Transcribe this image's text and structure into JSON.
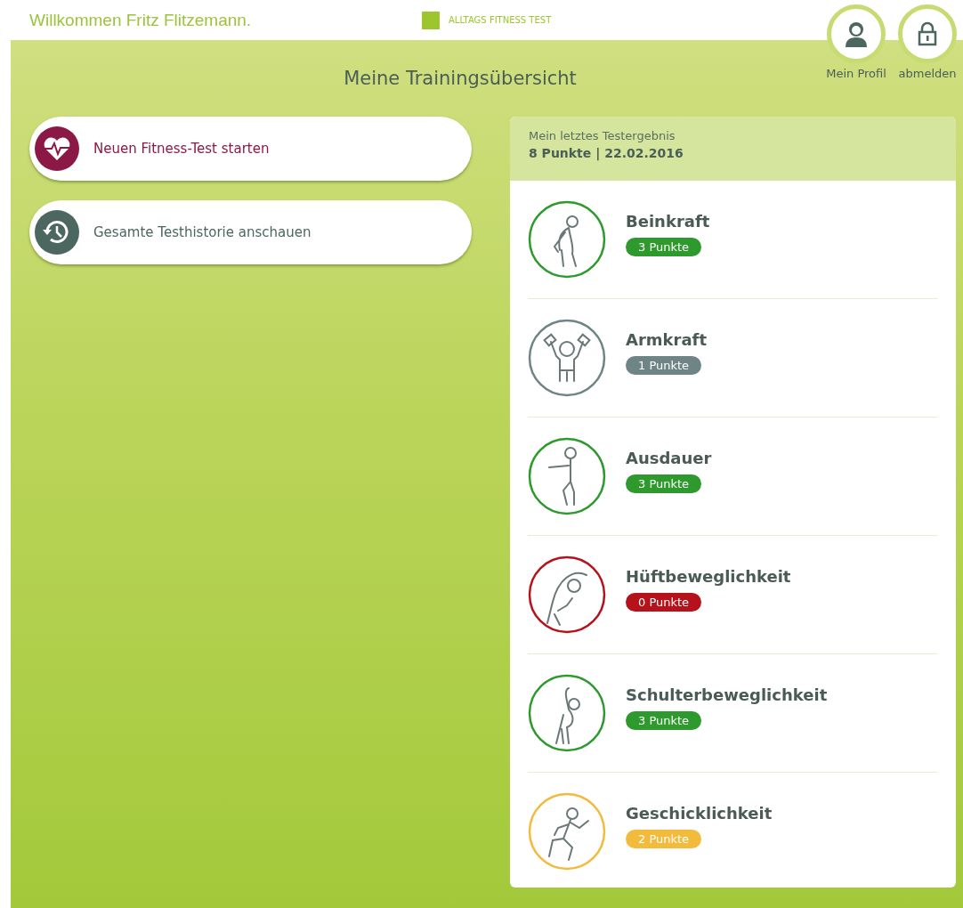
{
  "header": {
    "welcome": "Willkommen Fritz Flitzemann.",
    "brand": "ALLTAGS FITNESS TEST",
    "title": "Meine Trainingsübersicht"
  },
  "user_menu": [
    {
      "label": "Mein Profil"
    },
    {
      "label": "abmelden"
    }
  ],
  "actions": [
    {
      "label": "Neuen Fitness-Test starten",
      "color": "#8c1845"
    },
    {
      "label": "Gesamte Testhistorie anschauen",
      "color": "#4c6660"
    }
  ],
  "last_result": {
    "label": "Mein letztes Testergebnis",
    "summary": "8 Punkte | 22.02.2016"
  },
  "categories": [
    {
      "name": "Beinkraft",
      "points": "3 Punkte",
      "color": "#2e9a2e"
    },
    {
      "name": "Armkraft",
      "points": "1 Punkte",
      "color": "#6f8585"
    },
    {
      "name": "Ausdauer",
      "points": "3 Punkte",
      "color": "#2e9a2e"
    },
    {
      "name": "Hüftbeweglichkeit",
      "points": "0 Punkte",
      "color": "#b5121b"
    },
    {
      "name": "Schulterbeweglichkeit",
      "points": "3 Punkte",
      "color": "#2e9a2e"
    },
    {
      "name": "Geschicklichkeit",
      "points": "2 Punkte",
      "color": "#f2bb3c"
    }
  ]
}
